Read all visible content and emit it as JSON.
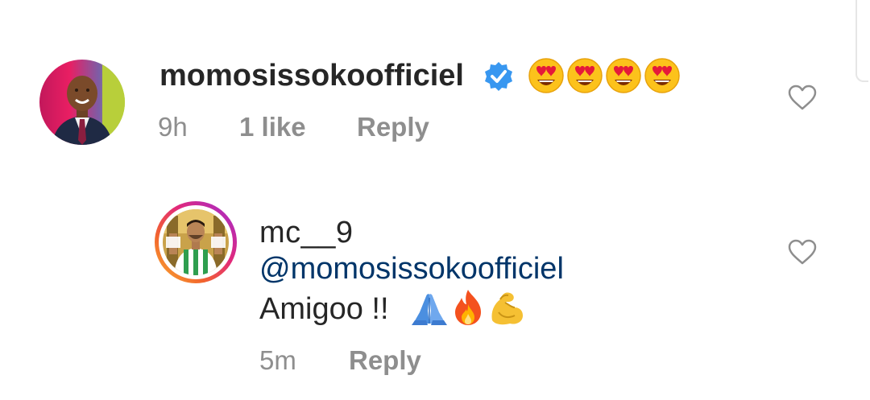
{
  "comments": [
    {
      "username": "momosissokoofficiel",
      "verified": true,
      "text_emojis": [
        "heart-eyes",
        "heart-eyes",
        "heart-eyes",
        "heart-eyes"
      ],
      "time": "9h",
      "likes": "1 like",
      "reply_label": "Reply",
      "like_icon": "heart-outline-icon"
    }
  ],
  "reply": {
    "username": "mc__9",
    "mention": "@momosissokoofficiel",
    "text": "Amigoo !!",
    "text_emojis": [
      "folded-hands",
      "fire",
      "flexed-biceps"
    ],
    "time": "5m",
    "reply_label": "Reply",
    "like_icon": "heart-outline-icon",
    "story_ring": true
  },
  "colors": {
    "text": "#262626",
    "meta": "#8e8e8e",
    "mention": "#003569",
    "verified": "#3897f0"
  }
}
